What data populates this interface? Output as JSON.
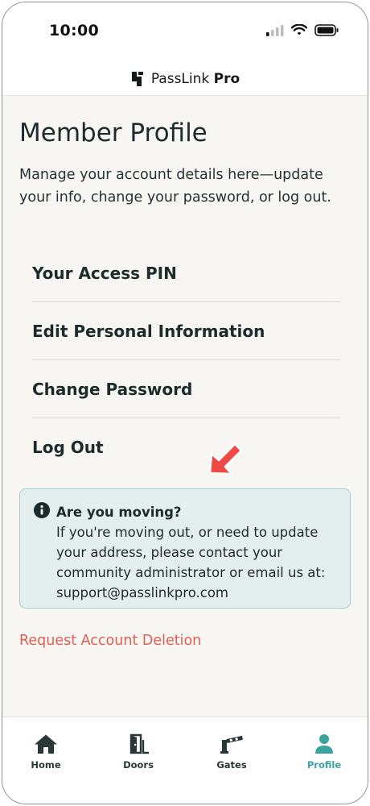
{
  "status_bar": {
    "time": "10:00"
  },
  "brand": {
    "name_light": "PassLink",
    "name_bold": "Pro"
  },
  "page": {
    "title": "Member Profile",
    "subtitle": "Manage your account details here—update your info, change your password, or log out."
  },
  "menu": [
    {
      "label": "Your Access PIN"
    },
    {
      "label": "Edit Personal Information"
    },
    {
      "label": "Change Password"
    },
    {
      "label": "Log Out"
    }
  ],
  "notice": {
    "title": "Are you moving?",
    "body": "If you're moving out, or need to update your address, please contact your community administrator or email us at: support@passlinkpro.com",
    "icon": "info-icon"
  },
  "delete_link": "Request Account Deletion",
  "tabs": [
    {
      "label": "Home",
      "icon": "home-icon"
    },
    {
      "label": "Doors",
      "icon": "door-icon"
    },
    {
      "label": "Gates",
      "icon": "gate-icon"
    },
    {
      "label": "Profile",
      "icon": "profile-icon",
      "active": true
    }
  ],
  "colors": {
    "accent": "#3aa3a0",
    "danger": "#e25d52",
    "arrow": "#ef4a45",
    "notice_bg": "#e4efed",
    "notice_border": "#9fcfcc",
    "text_dark": "#1c2b2c"
  }
}
